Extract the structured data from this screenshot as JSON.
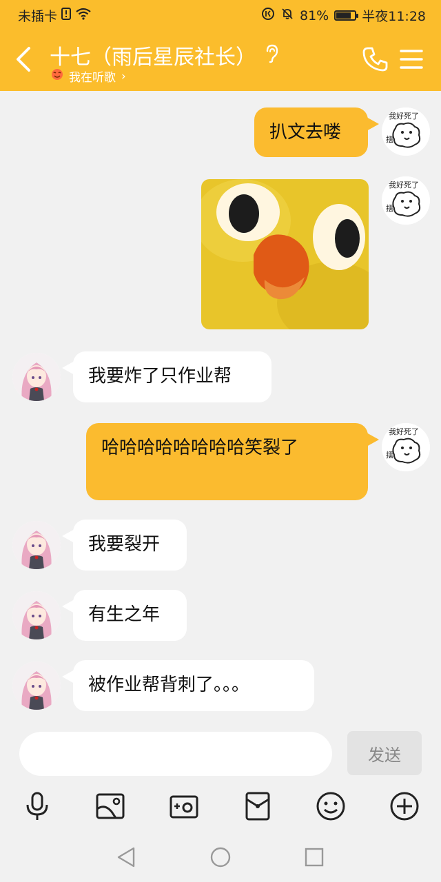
{
  "status_bar": {
    "carrier": "未插卡",
    "battery_percent": "81%",
    "battery_level": 0.81,
    "time": "半夜11:28"
  },
  "header": {
    "title": "十七（雨后星辰社长）",
    "subtitle": "我在听歌",
    "subtitle_chevron": "›",
    "accent_color": "#fbbd2c"
  },
  "messages": [
    {
      "side": "out",
      "type": "text",
      "text": "扒文去喽"
    },
    {
      "side": "out",
      "type": "sticker",
      "text": ""
    },
    {
      "side": "in",
      "type": "text",
      "text": "我要炸了只作业帮"
    },
    {
      "side": "out",
      "type": "text",
      "text": "哈哈哈哈哈哈哈哈笑裂了"
    },
    {
      "side": "in",
      "type": "text",
      "text": "我要裂开"
    },
    {
      "side": "in",
      "type": "text",
      "text": "有生之年"
    },
    {
      "side": "in",
      "type": "text",
      "text": "被作业帮背刺了。。。"
    }
  ],
  "input": {
    "placeholder": "",
    "send_label": "发送"
  },
  "toolbar": {
    "icons": [
      "microphone-icon",
      "image-icon",
      "camera-icon",
      "red-packet-icon",
      "emoji-icon",
      "plus-icon"
    ]
  },
  "navbar": {
    "icons": [
      "back-triangle-icon",
      "home-circle-icon",
      "recent-square-icon"
    ]
  }
}
